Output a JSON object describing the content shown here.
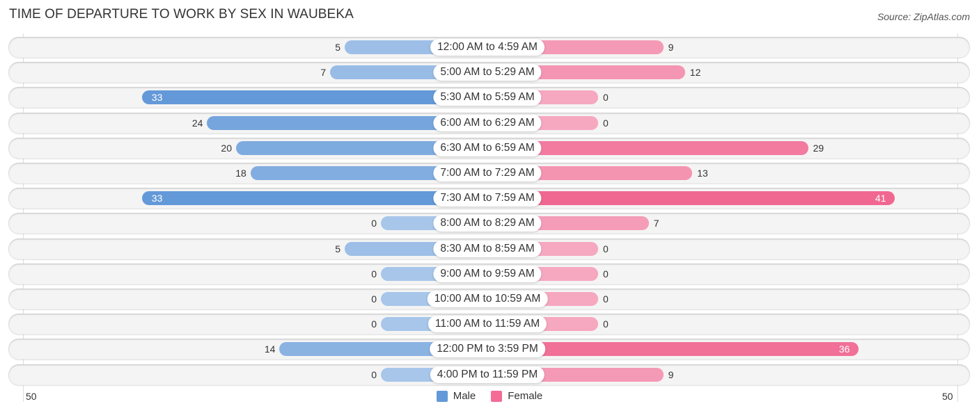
{
  "title": "TIME OF DEPARTURE TO WORK BY SEX IN WAUBEKA",
  "source": "Source: ZipAtlas.com",
  "colors": {
    "male_strong": "#6399d8",
    "male_light": "#a7c6ea",
    "female_strong": "#f06892",
    "female_light": "#f6a8c0"
  },
  "legend": [
    {
      "label": "Male",
      "color": "#6399d8"
    },
    {
      "label": "Female",
      "color": "#f46b95"
    }
  ],
  "axis": {
    "left_tick": "50",
    "right_tick": "50"
  },
  "chart_data": {
    "type": "bar",
    "orientation": "horizontal-diverging",
    "title": "TIME OF DEPARTURE TO WORK BY SEX IN WAUBEKA",
    "xlim": [
      -50,
      50
    ],
    "xtick_labels": [
      "50",
      "50"
    ],
    "legend_position": "bottom-center",
    "categories": [
      "12:00 AM to 4:59 AM",
      "5:00 AM to 5:29 AM",
      "5:30 AM to 5:59 AM",
      "6:00 AM to 6:29 AM",
      "6:30 AM to 6:59 AM",
      "7:00 AM to 7:29 AM",
      "7:30 AM to 7:59 AM",
      "8:00 AM to 8:29 AM",
      "8:30 AM to 8:59 AM",
      "9:00 AM to 9:59 AM",
      "10:00 AM to 10:59 AM",
      "11:00 AM to 11:59 AM",
      "12:00 PM to 3:59 PM",
      "4:00 PM to 11:59 PM"
    ],
    "series": [
      {
        "name": "Male",
        "values": [
          5,
          7,
          33,
          24,
          20,
          18,
          33,
          0,
          5,
          0,
          0,
          0,
          14,
          0
        ]
      },
      {
        "name": "Female",
        "values": [
          9,
          12,
          0,
          0,
          29,
          13,
          41,
          7,
          0,
          0,
          0,
          0,
          36,
          9
        ]
      }
    ]
  }
}
